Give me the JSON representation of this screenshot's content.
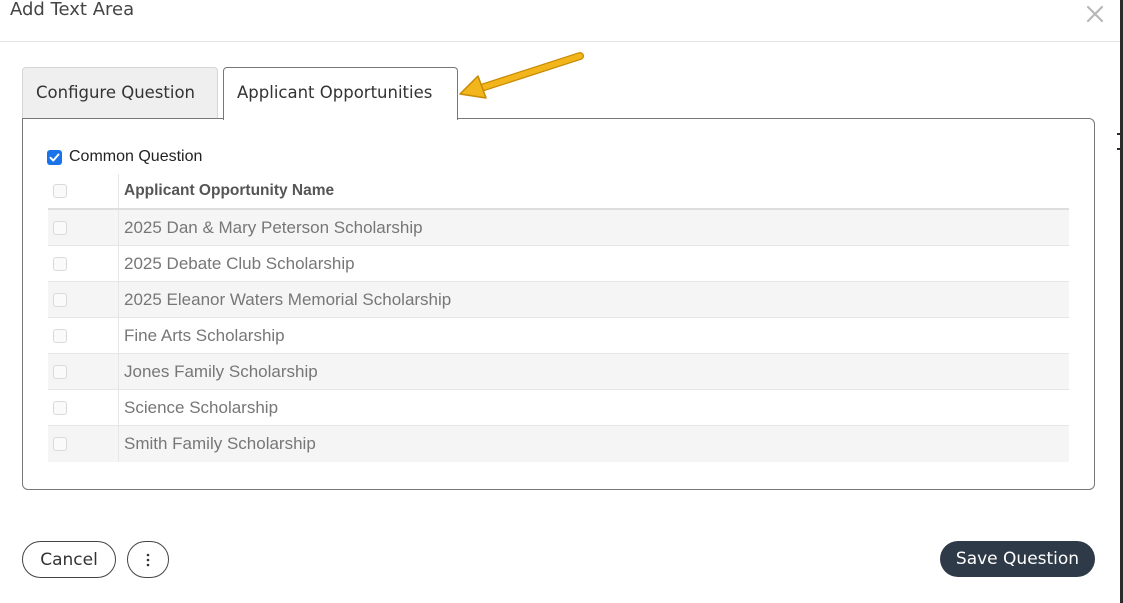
{
  "modal": {
    "title": "Add Text Area",
    "close_icon": "close-icon"
  },
  "tabs": [
    {
      "label": "Configure Question",
      "active": false
    },
    {
      "label": "Applicant Opportunities",
      "active": true
    }
  ],
  "common_question": {
    "label": "Common Question",
    "checked": true
  },
  "table": {
    "header": "Applicant Opportunity Name",
    "rows": [
      "2025 Dan & Mary Peterson Scholarship",
      "2025 Debate Club Scholarship",
      "2025 Eleanor Waters Memorial Scholarship",
      "Fine Arts Scholarship",
      "Jones Family Scholarship",
      "Science Scholarship",
      "Smith Family Scholarship"
    ]
  },
  "footer": {
    "cancel_label": "Cancel",
    "more_icon": "vertical-ellipsis-icon",
    "save_label": "Save Question"
  },
  "colors": {
    "accent": "#1a73e8",
    "save_button": "#2f3a48",
    "annotation_arrow": "#f2b51c"
  }
}
